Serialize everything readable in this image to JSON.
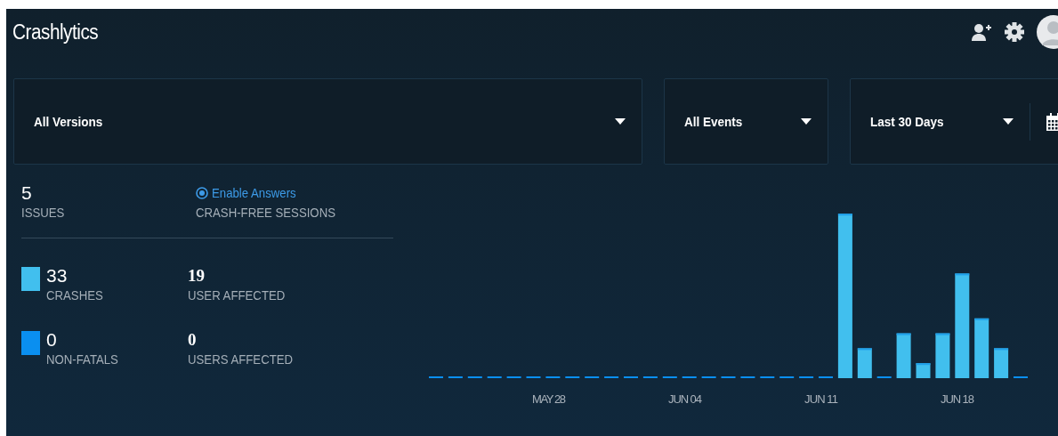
{
  "header": {
    "title": "Crashlytics"
  },
  "filters": [
    {
      "kind": "dropdown",
      "label": "All Versions"
    },
    {
      "kind": "dropdown",
      "label": "All Events"
    },
    {
      "kind": "date",
      "label": "Last 30 Days"
    }
  ],
  "summary": {
    "issues_value": "5",
    "issues_label": "ISSUES",
    "answers_link": "Enable Answers",
    "sessions_label": "CRASH-FREE SESSIONS"
  },
  "metrics": [
    {
      "value": "33",
      "label": "CRASHES",
      "color": "#41bfee",
      "users_value": "19",
      "users_label": "USER AFFECTED"
    },
    {
      "value": "0",
      "label": "NON-FATALS",
      "color": "#0a8ff0",
      "users_value": "0",
      "users_label": "USERS AFFECTED"
    }
  ],
  "chart": {
    "x_labels": [
      "MAY 28",
      "JUN 04",
      "JUN 11",
      "JUN 18"
    ]
  }
}
